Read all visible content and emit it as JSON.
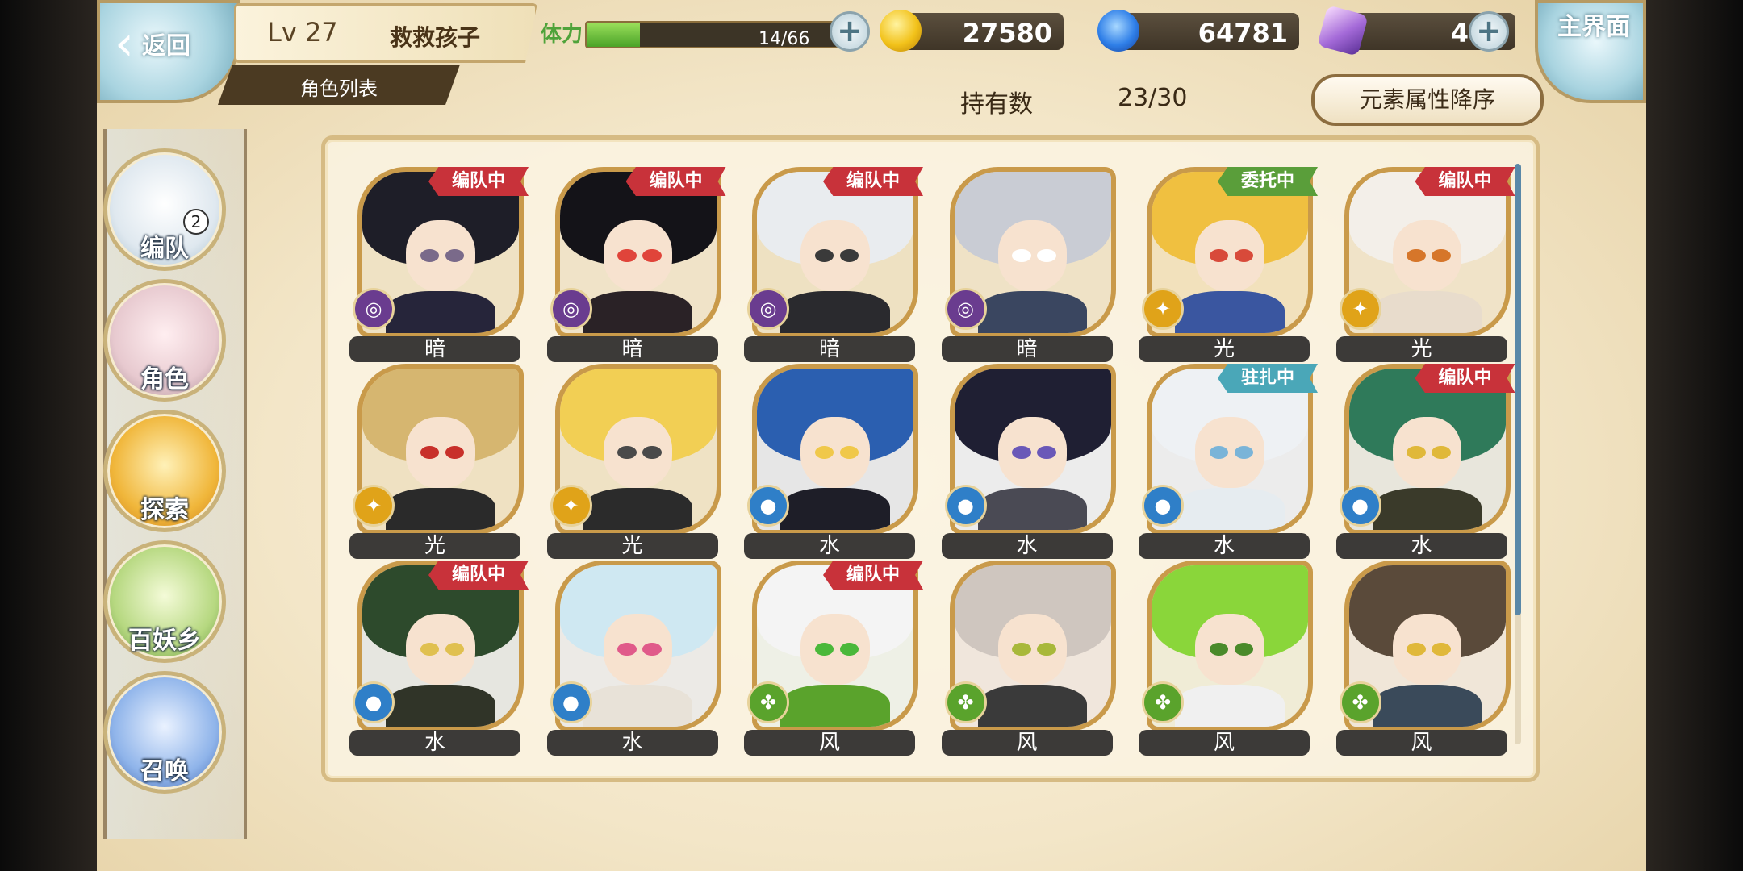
{
  "header": {
    "back_label": "返回",
    "level": "Lv 27",
    "player_name": "救救孩子",
    "list_tab": "角色列表",
    "stamina_label": "体力",
    "stamina_text": "14/66",
    "stamina_current": 14,
    "stamina_max": 66,
    "gold": "27580",
    "water": "64781",
    "crystal": "4",
    "home_label": "主界面"
  },
  "toolbar": {
    "owned_label": "持有数",
    "owned_value": "23/30",
    "sort_label": "元素属性降序"
  },
  "side_menu": [
    {
      "label": "编队",
      "badge": "2"
    },
    {
      "label": "角色"
    },
    {
      "label": "探索"
    },
    {
      "label": "百妖乡"
    },
    {
      "label": "召唤"
    }
  ],
  "element_colors": {
    "暗": "#6a3c8f",
    "光": "#e0a319",
    "水": "#2f7fc8",
    "风": "#5aa32c"
  },
  "status_colors": {
    "编队中": "#c8323a",
    "委托中": "#5a9e3a",
    "驻扎中": "#4aa7b8"
  },
  "characters": [
    {
      "element": "暗",
      "status": "编队中",
      "hair": "#1e1e28",
      "eye": "#7a6a8a",
      "outfit": "#26253a",
      "bg": "#efe2c4"
    },
    {
      "element": "暗",
      "status": "编队中",
      "hair": "#141318",
      "eye": "#e0443a",
      "outfit": "#2a2226",
      "bg": "#f0e3c8"
    },
    {
      "element": "暗",
      "status": "编队中",
      "hair": "#e9ecef",
      "eye": "#3a3a3a",
      "outfit": "#2a2a2e",
      "bg": "#eee1c2"
    },
    {
      "element": "暗",
      "status": "",
      "hair": "#c9ccd4",
      "eye": "#ffffff",
      "outfit": "#3a4660",
      "bg": "#efe2c6"
    },
    {
      "element": "光",
      "status": "委托中",
      "hair": "#f0c040",
      "eye": "#d84a3a",
      "outfit": "#3a56a0",
      "bg": "#f2e1bc"
    },
    {
      "element": "光",
      "status": "编队中",
      "hair": "#f3efe9",
      "eye": "#d6762a",
      "outfit": "#e8dccc",
      "bg": "#f0e3c8"
    },
    {
      "element": "光",
      "status": "",
      "hair": "#d6b670",
      "eye": "#c8302a",
      "outfit": "#2a2a2a",
      "bg": "#efe1c2"
    },
    {
      "element": "光",
      "status": "",
      "hair": "#f2cf54",
      "eye": "#4a4a4a",
      "outfit": "#2b2b2b",
      "bg": "#efe2c4"
    },
    {
      "element": "水",
      "status": "",
      "hair": "#2b5fb0",
      "eye": "#f0c84a",
      "outfit": "#1e1e28",
      "bg": "#e6e6e6"
    },
    {
      "element": "水",
      "status": "",
      "hair": "#1f1f33",
      "eye": "#6a58b8",
      "outfit": "#4a4a54",
      "bg": "#ececec"
    },
    {
      "element": "水",
      "status": "驻扎中",
      "hair": "#eef1f4",
      "eye": "#7ab4d8",
      "outfit": "#e6ecf0",
      "bg": "#ececec"
    },
    {
      "element": "水",
      "status": "编队中",
      "hair": "#2f7a5a",
      "eye": "#e0b83a",
      "outfit": "#3a3a2a",
      "bg": "#e8e6dc"
    },
    {
      "element": "水",
      "status": "编队中",
      "hair": "#2d4a2c",
      "eye": "#e0c050",
      "outfit": "#303428",
      "bg": "#e6e6e0"
    },
    {
      "element": "水",
      "status": "",
      "hair": "#cfe8f2",
      "eye": "#e05a8a",
      "outfit": "#e8e2d8",
      "bg": "#eceae6"
    },
    {
      "element": "风",
      "status": "编队中",
      "hair": "#f4f4f4",
      "eye": "#4ab83a",
      "outfit": "#5aa32c",
      "bg": "#eef0e6"
    },
    {
      "element": "风",
      "status": "",
      "hair": "#cfc6bf",
      "eye": "#a8b83a",
      "outfit": "#3a3a3a",
      "bg": "#f0e6dc"
    },
    {
      "element": "风",
      "status": "",
      "hair": "#8ad63a",
      "eye": "#4a8a2a",
      "outfit": "#f0f0f0",
      "bg": "#f0ecd6"
    },
    {
      "element": "风",
      "status": "",
      "hair": "#5a4a3a",
      "eye": "#e0b83a",
      "outfit": "#3a4a5a",
      "bg": "#f0e6d8"
    }
  ]
}
